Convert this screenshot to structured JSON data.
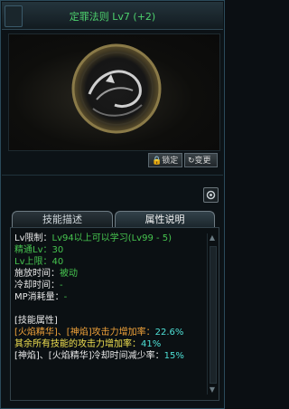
{
  "window": {
    "title": "定罪法则 Lv7 (+2)"
  },
  "buttons": {
    "lock_label": "锁定",
    "change_label": "变更"
  },
  "tabs": {
    "description": "技能描述",
    "attributes": "属性说明"
  },
  "details": {
    "lv_limit_label": "Lv限制：",
    "lv_limit_value": "Lv94以上可以学习(Lv99 - 5)",
    "mastery_label": "精通Lv：",
    "mastery_value": "30",
    "lv_cap_label": "Lv上限：",
    "lv_cap_value": "40",
    "cast_time_label": "施放时间：",
    "cast_time_value": "被动",
    "cooldown_label": "冷却时间：",
    "cooldown_value": "-",
    "mp_cost_label": "MP消耗量：",
    "mp_cost_value": "-",
    "section_header": "[技能属性]",
    "attr1_label": "[火焰精华]、[神焰]攻击力增加率：",
    "attr1_value": "22.6%",
    "attr2_label": "其余所有技能的攻击力增加率：",
    "attr2_value": "41%",
    "attr3_label": "[神焰]、[火焰精华]冷却时间减少率：",
    "attr3_value": "15%"
  },
  "icons": {
    "lock": "lock-icon",
    "change": "refresh-icon",
    "settings": "gear-icon",
    "emblem": "skill-emblem-icon"
  },
  "colors": {
    "title": "#4dd06d",
    "green_value": "#46c44f",
    "orange_value": "#f0a23a",
    "yellow_value": "#f0e050",
    "cyan_value": "#4ee0d6"
  }
}
